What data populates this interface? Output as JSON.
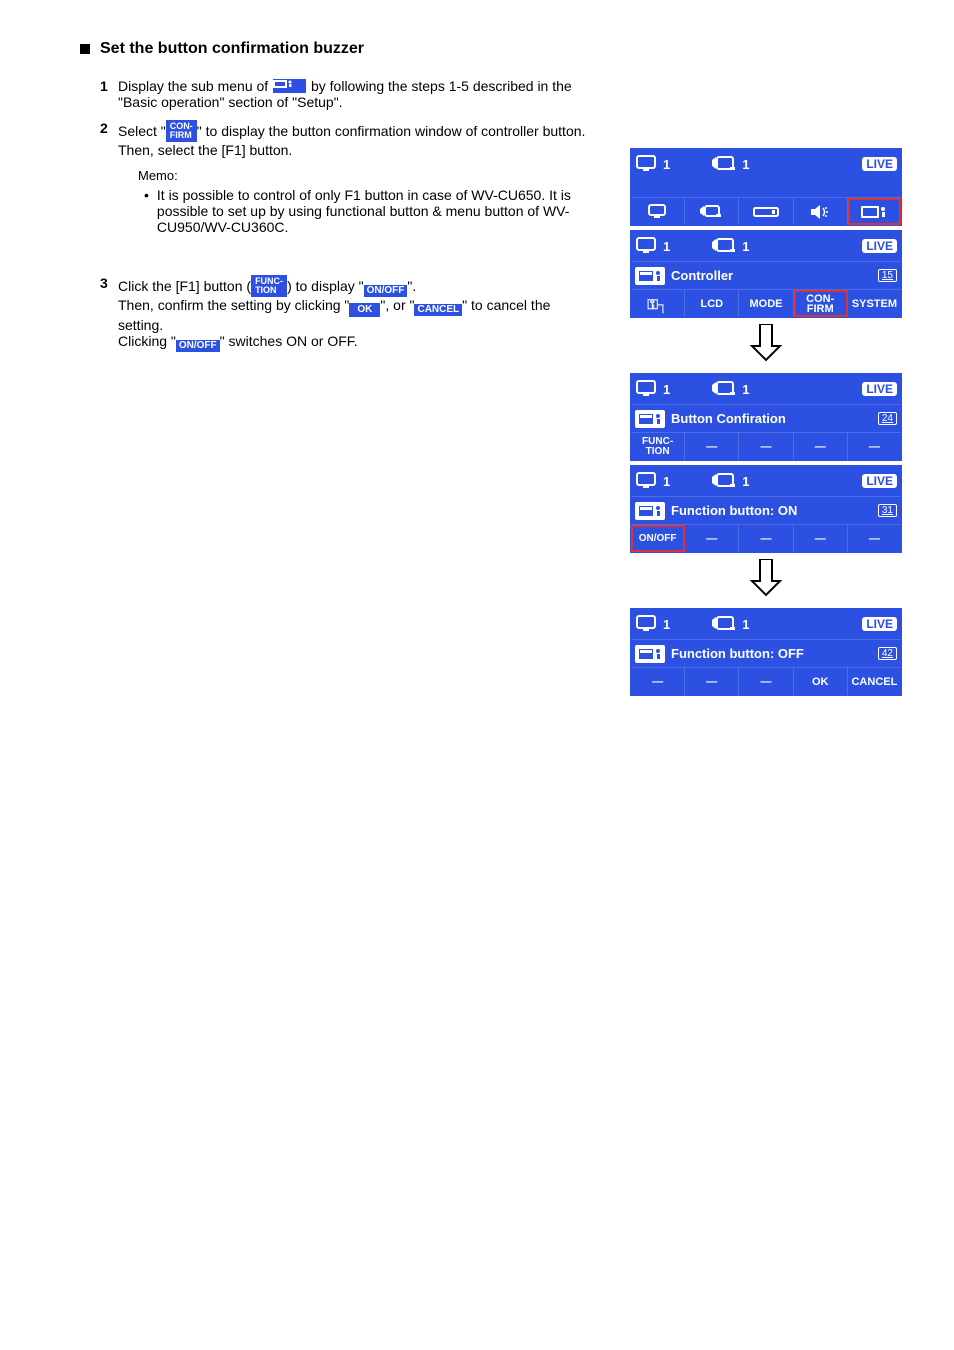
{
  "section_title": "Set the button confirmation buzzer",
  "steps": {
    "1": {
      "text_before": "Display the sub menu of ",
      "text_after": " by following the steps 1-5 described in the \"Basic operation\" section of \"Setup\"."
    },
    "2": {
      "text_before_icon": "Select \"",
      "confirm_top": "CON-",
      "confirm_bottom": "FIRM",
      "text_after_icon": "\" to display the button confirmation window of controller button.",
      "then_before": "Then, select the [F1] button.",
      "memo_label": "Memo:",
      "memo_text": "It is possible to control of only F1 button in case of WV-CU650. It is possible to set up by using functional button & menu button of WV-CU950/WV-CU360C."
    },
    "3": {
      "before_func": "Click the [F1] button (",
      "after_func_before_onoff": ") to display \"",
      "after_onoff1": "\".",
      "then_confirm": "Then, confirm the setting by clicking \"",
      "ok": "OK",
      "after_ok": "\", or \"",
      "cancel": "CANCEL",
      "after_cancel": "\" to cancel the setting.",
      "last_before": "Clicking \"",
      "last_after": "\" switches ON or OFF.",
      "func_top": "FUNC-",
      "func_bottom": "TION",
      "onoff": "ON/OFF"
    }
  },
  "right": {
    "live": "LIVE",
    "num1": "1",
    "screen2": {
      "title": "Controller",
      "page": "15",
      "btns": [
        "",
        "LCD",
        "MODE",
        "CON-\nFIRM",
        "SYSTEM"
      ]
    },
    "screen3": {
      "title": "Button Confiration",
      "page": "24",
      "btns": [
        "FUNC-\nTION",
        "—",
        "—",
        "—",
        "—"
      ]
    },
    "screen4": {
      "title": "Function button: ON",
      "page": "31",
      "btns": [
        "ON/OFF",
        "—",
        "—",
        "—",
        "—"
      ]
    },
    "screen5": {
      "title": "Function button: OFF",
      "page": "42",
      "btns": [
        "—",
        "—",
        "—",
        "OK",
        "CANCEL"
      ]
    }
  }
}
